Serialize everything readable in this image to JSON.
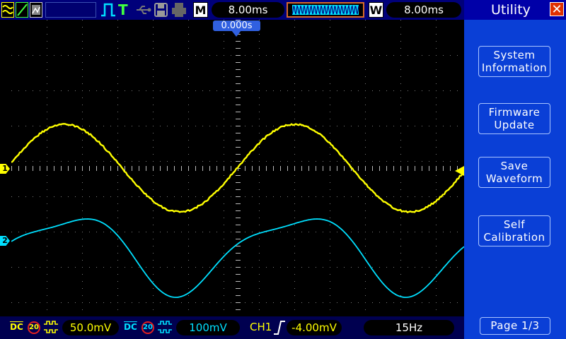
{
  "top_bar": {
    "trigger_mode_glyph": "T",
    "memory_label": "M",
    "timebase": "8.00ms",
    "window_label": "W",
    "window_timebase": "8.00ms",
    "trigger_position": "0.000s"
  },
  "panel": {
    "title": "Utility",
    "close_glyph": "✕",
    "buttons": [
      {
        "line1": "System",
        "line2": "Information"
      },
      {
        "line1": "Firmware",
        "line2": "Update"
      },
      {
        "line1": "Save",
        "line2": "Waveform"
      },
      {
        "line1": "Self",
        "line2": "Calibration"
      }
    ],
    "page": "Page 1/3"
  },
  "channels": {
    "ch1": {
      "marker": "1",
      "color": "#ffff00",
      "coupling": "DC",
      "bw_limit": "20",
      "scale": "50.0mV"
    },
    "ch2": {
      "marker": "2",
      "color": "#00e0ff",
      "coupling": "DC",
      "bw_limit": "20",
      "scale": "100mV"
    }
  },
  "trigger": {
    "source": "CH1",
    "level": "-4.00mV",
    "frequency": "15Hz",
    "level_color": "#ffff00"
  },
  "colors": {
    "panel": "#0a3fd6",
    "topbar": "#00007a",
    "grid": "#7a7a7a",
    "ch1": "#ffff00",
    "ch2": "#00e0ff"
  }
}
